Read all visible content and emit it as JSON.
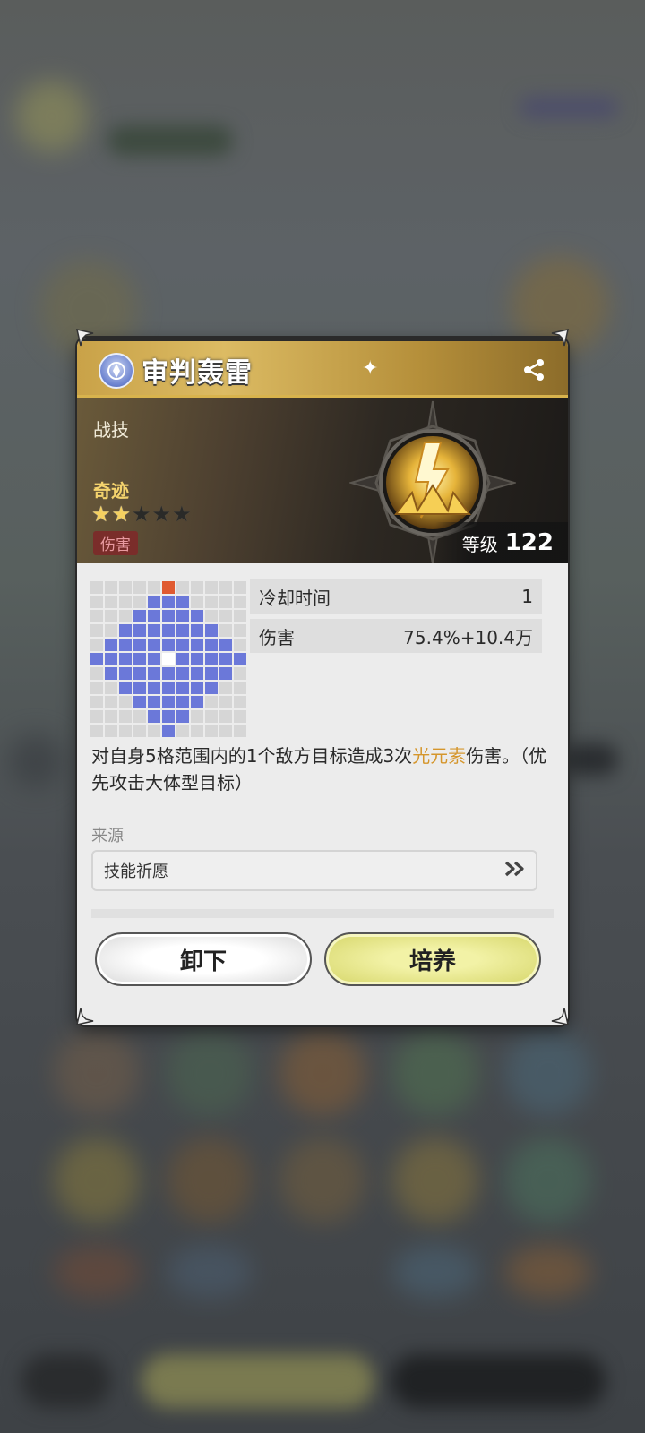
{
  "skill": {
    "name": "审判轰雷",
    "type": "战技",
    "rarity": "奇迹",
    "stars_filled": 2,
    "stars_total": 5,
    "tag": "伤害",
    "level_label": "等级",
    "level_value": "122"
  },
  "stats": [
    {
      "label": "冷却时间",
      "value": "1"
    },
    {
      "label": "伤害",
      "value": "75.4%+10.4万"
    }
  ],
  "description": {
    "part1": "对自身5格范围内的1个敌方目标造成3次",
    "highlight": "光元素",
    "part2": "伤害。（优先攻击大体型目标）",
    "highlight_color": "#d5962c"
  },
  "source": {
    "label": "来源",
    "value": "技能祈愿"
  },
  "buttons": {
    "unequip": "卸下",
    "train": "培养"
  },
  "range_grid": {
    "size": 11,
    "radius": 5
  },
  "colors": {
    "range": "#6b78d9",
    "center": "#ffffff",
    "target": "#e05a30",
    "empty": "#d6d6d6",
    "tag_bg": "#7a2d2a",
    "rarity": "#f4d36d"
  },
  "icons": {
    "title": "light-element-icon",
    "share": "share-icon",
    "source_arrow": "double-chevron-right-icon",
    "emblem": "lightning-strike-icon"
  }
}
